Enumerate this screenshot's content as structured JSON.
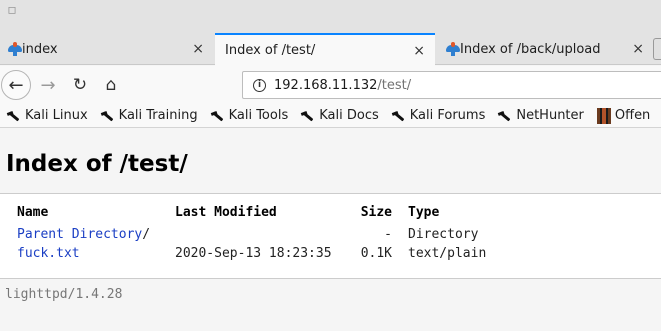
{
  "browser": {
    "tabs": [
      {
        "label": "index",
        "active": false
      },
      {
        "label": "Index of /test/",
        "active": true
      },
      {
        "label": "Index of /back/upload",
        "active": false
      }
    ],
    "close_glyph": "×",
    "url": {
      "host": "192.168.11.132",
      "path": "/test/"
    },
    "bookmarks": [
      {
        "label": "Kali Linux",
        "icon": "kali-dragon-icon"
      },
      {
        "label": "Kali Training",
        "icon": "kali-dragon-icon"
      },
      {
        "label": "Kali Tools",
        "icon": "kali-dragon-icon"
      },
      {
        "label": "Kali Docs",
        "icon": "kali-dragon-icon"
      },
      {
        "label": "Kali Forums",
        "icon": "kali-dragon-icon"
      },
      {
        "label": "NetHunter",
        "icon": "kali-dragon-icon"
      },
      {
        "label": "Offen",
        "icon": "offsec-icon"
      }
    ]
  },
  "page": {
    "title": "Index of /test/",
    "columns": {
      "name": "Name",
      "modified": "Last Modified",
      "size": "Size",
      "type": "Type"
    },
    "parent": {
      "name": "Parent Directory",
      "slash": "/",
      "modified": "",
      "size": "-",
      "type": "Directory"
    },
    "files": [
      {
        "name": "fuck.txt",
        "modified": "2020-Sep-13 18:23:35",
        "size": "0.1K",
        "type": "text/plain"
      }
    ],
    "footer": "lighttpd/1.4.28"
  }
}
